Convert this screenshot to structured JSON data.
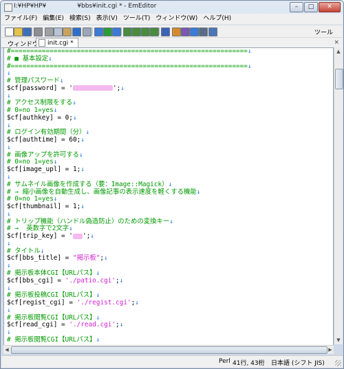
{
  "window": {
    "title": "I:¥HP¥HP¥     ¥bbs¥init.cgi * - EmEditor",
    "buttons": {
      "minimize": "–",
      "maximize": "□",
      "close": "✕"
    }
  },
  "menu": [
    {
      "label": "ファイル(F)"
    },
    {
      "label": "編集(E)"
    },
    {
      "label": "検索(S)"
    },
    {
      "label": "表示(V)"
    },
    {
      "label": "ツール(T)"
    },
    {
      "label": "ウィンドウ(W)"
    },
    {
      "label": "ヘルプ(H)"
    }
  ],
  "toolbar": {
    "right_label": "ツール",
    "icons": [
      {
        "name": "new-file-icon",
        "color": "#ffffff"
      },
      {
        "name": "open-folder-icon",
        "color": "#e8c24a"
      },
      {
        "name": "save-icon",
        "color": "#3d6fb8"
      },
      {
        "name": "print-icon",
        "color": "#8e8e8e"
      },
      {
        "name": "cut-icon",
        "color": "#a0a0a0"
      },
      {
        "name": "copy-icon",
        "color": "#b8c4d4"
      },
      {
        "name": "paste-icon",
        "color": "#c9a35e"
      },
      {
        "name": "undo-icon",
        "color": "#2f6fc7"
      },
      {
        "name": "redo-icon",
        "color": "#9aa5b5"
      },
      {
        "name": "find-icon",
        "color": "#3a7bd5"
      },
      {
        "name": "find-next-icon",
        "color": "#2c9b3a"
      },
      {
        "name": "replace-icon",
        "color": "#3a7bd5"
      },
      {
        "name": "layout-1-icon",
        "color": "#4a8b3e"
      },
      {
        "name": "layout-2-icon",
        "color": "#4a8b3e"
      },
      {
        "name": "layout-3-icon",
        "color": "#4a8b3e"
      },
      {
        "name": "layout-4-icon",
        "color": "#4a8b3e"
      },
      {
        "name": "config-icon",
        "color": "#3c63b8"
      },
      {
        "name": "macro-1-icon",
        "color": "#d58a2a"
      },
      {
        "name": "macro-2-icon",
        "color": "#7a58b0"
      },
      {
        "name": "macro-3-icon",
        "color": "#3a7bd5"
      },
      {
        "name": "macro-dropdown-icon",
        "color": "#5a6c85"
      },
      {
        "name": "plugin-icon",
        "color": "#4a76b5"
      }
    ]
  },
  "tabbar": {
    "label": "ウィンドウ",
    "tabs": [
      {
        "label": "init.cgi *"
      }
    ],
    "close": "×"
  },
  "editor": {
    "lines": [
      [
        {
          "t": "#=============================================================",
          "c": "comment"
        },
        {
          "t": "↓",
          "c": "eol"
        }
      ],
      [
        {
          "t": "# ■ 基本設定",
          "c": "comment"
        },
        {
          "t": "↓",
          "c": "eol"
        }
      ],
      [
        {
          "t": "#=============================================================",
          "c": "comment"
        },
        {
          "t": "↓",
          "c": "eol"
        }
      ],
      [
        {
          "t": "↓",
          "c": "eol"
        }
      ],
      [
        {
          "t": "# 管理パスワード",
          "c": "comment"
        },
        {
          "t": "↓",
          "c": "eol"
        }
      ],
      [
        {
          "t": "$cf[password] = '",
          "c": "var"
        },
        {
          "t": "",
          "c": "blur"
        },
        {
          "t": "';",
          "c": "var"
        },
        {
          "t": "↓",
          "c": "eol"
        }
      ],
      [
        {
          "t": "↓",
          "c": "eol"
        }
      ],
      [
        {
          "t": "# アクセス制限をする",
          "c": "comment"
        },
        {
          "t": "↓",
          "c": "eol"
        }
      ],
      [
        {
          "t": "# 0=no 1=yes",
          "c": "comment"
        },
        {
          "t": "↓",
          "c": "eol"
        }
      ],
      [
        {
          "t": "$cf[authkey] = 0;",
          "c": "var"
        },
        {
          "t": "↓",
          "c": "eol"
        }
      ],
      [
        {
          "t": "↓",
          "c": "eol"
        }
      ],
      [
        {
          "t": "# ログイン有効期間（分）",
          "c": "comment"
        },
        {
          "t": "↓",
          "c": "eol"
        }
      ],
      [
        {
          "t": "$cf[authtime] = 60;",
          "c": "var"
        },
        {
          "t": "↓",
          "c": "eol"
        }
      ],
      [
        {
          "t": "↓",
          "c": "eol"
        }
      ],
      [
        {
          "t": "# 画像アップを許可する",
          "c": "comment"
        },
        {
          "t": "↓",
          "c": "eol"
        }
      ],
      [
        {
          "t": "# 0=no 1=yes",
          "c": "comment"
        },
        {
          "t": "↓",
          "c": "eol"
        }
      ],
      [
        {
          "t": "$cf[image_upl] = 1;",
          "c": "var"
        },
        {
          "t": "↓",
          "c": "eol"
        }
      ],
      [
        {
          "t": "↓",
          "c": "eol"
        }
      ],
      [
        {
          "t": "# サムネイル画像を作成する（要：Image::Magick）",
          "c": "comment"
        },
        {
          "t": "↓",
          "c": "eol"
        }
      ],
      [
        {
          "t": "# → 縮小画像を自動生成し、画像記事の表示速度を軽くする機能",
          "c": "comment"
        },
        {
          "t": "↓",
          "c": "eol"
        }
      ],
      [
        {
          "t": "# 0=no 1=yes",
          "c": "comment"
        },
        {
          "t": "↓",
          "c": "eol"
        }
      ],
      [
        {
          "t": "$cf[thumbnail] = 1;",
          "c": "var"
        },
        {
          "t": "↓",
          "c": "eol"
        }
      ],
      [
        {
          "t": "↓",
          "c": "eol"
        }
      ],
      [
        {
          "t": "# トリップ機能（ハンドル偽造防止）のための変換キー",
          "c": "comment"
        },
        {
          "t": "↓",
          "c": "eol"
        }
      ],
      [
        {
          "t": "# →  英数字で2文字",
          "c": "comment"
        },
        {
          "t": "↓",
          "c": "eol"
        }
      ],
      [
        {
          "t": "$cf[trip_key] = '",
          "c": "var"
        },
        {
          "t": "",
          "c": "blurshort"
        },
        {
          "t": "';",
          "c": "var"
        },
        {
          "t": "↓",
          "c": "eol"
        }
      ],
      [
        {
          "t": "↓",
          "c": "eol"
        }
      ],
      [
        {
          "t": "# タイトル",
          "c": "comment"
        },
        {
          "t": "↓",
          "c": "eol"
        }
      ],
      [
        {
          "t": "$cf[bbs_title] = ",
          "c": "var"
        },
        {
          "t": "\"掲示板\"",
          "c": "str"
        },
        {
          "t": ";",
          "c": "var"
        },
        {
          "t": "↓",
          "c": "eol"
        }
      ],
      [
        {
          "t": "↓",
          "c": "eol"
        }
      ],
      [
        {
          "t": "# 掲示板本体CGI【URLパス】",
          "c": "comment"
        },
        {
          "t": "↓",
          "c": "eol"
        }
      ],
      [
        {
          "t": "$cf[bbs_cgi] = ",
          "c": "var"
        },
        {
          "t": "'./patio.cgi'",
          "c": "str"
        },
        {
          "t": ";",
          "c": "var"
        },
        {
          "t": "↓",
          "c": "eol"
        }
      ],
      [
        {
          "t": "↓",
          "c": "eol"
        }
      ],
      [
        {
          "t": "# 掲示板投稿CGI【URLパス】",
          "c": "comment"
        },
        {
          "t": "↓",
          "c": "eol"
        }
      ],
      [
        {
          "t": "$cf[regist_cgi] = ",
          "c": "var"
        },
        {
          "t": "'./regist.cgi'",
          "c": "str"
        },
        {
          "t": ";",
          "c": "var"
        },
        {
          "t": "↓",
          "c": "eol"
        }
      ],
      [
        {
          "t": "↓",
          "c": "eol"
        }
      ],
      [
        {
          "t": "# 掲示板閲覧CGI【URLパス】",
          "c": "comment"
        },
        {
          "t": "↓",
          "c": "eol"
        }
      ],
      [
        {
          "t": "$cf[read_cgi] = ",
          "c": "var"
        },
        {
          "t": "'./read.cgi'",
          "c": "str"
        },
        {
          "t": ";",
          "c": "var"
        },
        {
          "t": "↓",
          "c": "eol"
        }
      ],
      [
        {
          "t": "↓",
          "c": "eol"
        }
      ],
      [
        {
          "t": "# 掲示板閲覧CGI【URLパス】",
          "c": "comment"
        },
        {
          "t": "↓",
          "c": "eol"
        }
      ]
    ]
  },
  "scrollbar": {
    "up": "▲",
    "down": "▼",
    "left": "◀",
    "right": "▶"
  },
  "status": {
    "mode": "Perl",
    "position": "41行, 43桁",
    "encoding": "日本語 (シフト JIS)"
  }
}
